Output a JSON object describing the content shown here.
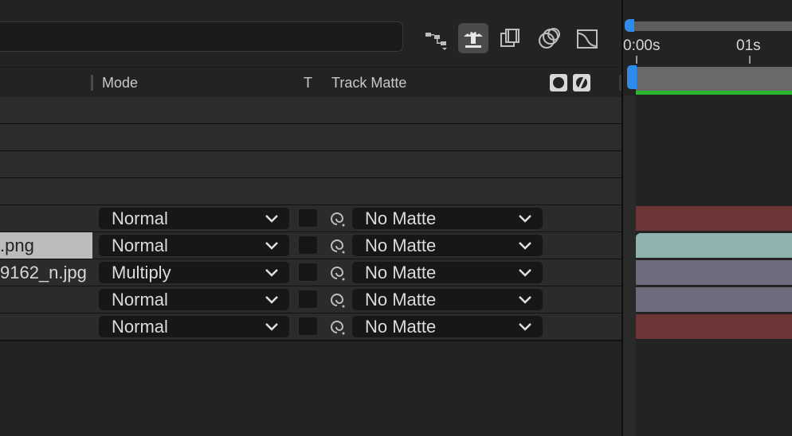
{
  "toolbar": {
    "icons": [
      {
        "name": "flowchart-icon"
      },
      {
        "name": "draft-3d-icon",
        "active": true
      },
      {
        "name": "frame-blending-icon"
      },
      {
        "name": "motion-blur-icon"
      },
      {
        "name": "graph-editor-icon"
      }
    ]
  },
  "header": {
    "mode_label": "Mode",
    "t_label": "T",
    "track_matte_label": "Track Matte"
  },
  "layers": [
    {
      "name": "",
      "mode": "Normal",
      "matte": "No Matte",
      "bar_color": "#6e3536"
    },
    {
      "name": ".png",
      "mode": "Normal",
      "matte": "No Matte",
      "selected": true,
      "bar_color": "#8fb3ae"
    },
    {
      "name": "9162_n.jpg",
      "mode": "Multiply",
      "matte": "No Matte",
      "bar_color": "#6d6c7c"
    },
    {
      "name": "",
      "mode": "Normal",
      "matte": "No Matte",
      "bar_color": "#6d6c7c"
    },
    {
      "name": "",
      "mode": "Normal",
      "matte": "No Matte",
      "bar_color": "#6e3536"
    }
  ],
  "timeline": {
    "tick_0": "0:00s",
    "tick_1": "01s",
    "work_area_color": "#2cb52c",
    "playhead_color": "#2d8ceb"
  }
}
